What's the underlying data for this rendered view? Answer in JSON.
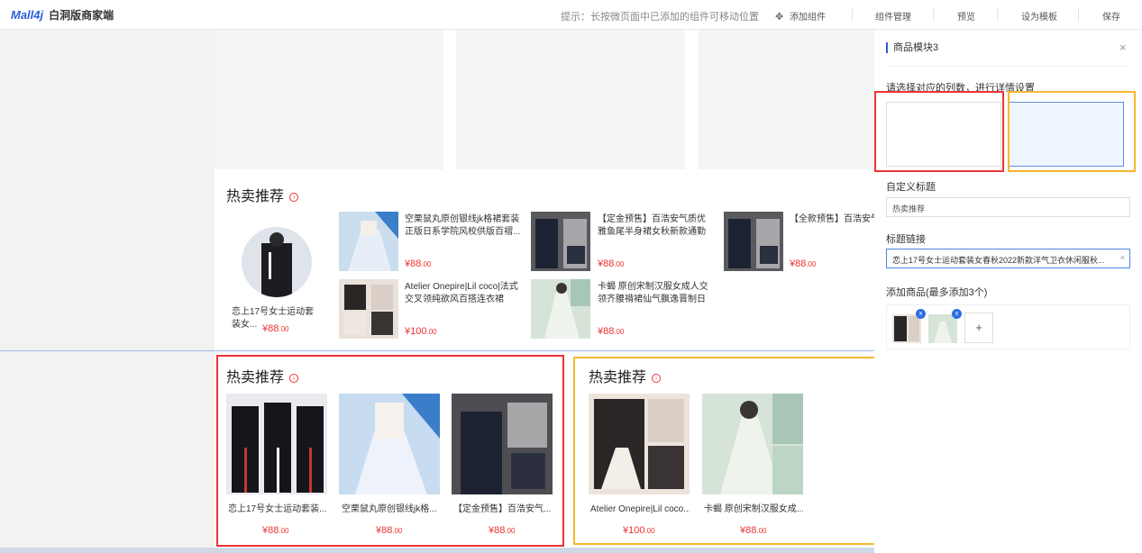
{
  "header": {
    "logo": "Mall4j",
    "subtitle": "白洞版商家端",
    "tip": "提示：长按微页面中已添加的组件可移动位置",
    "add_component": "添加组件",
    "component_manage": "组件管理",
    "preview": "预览",
    "set_template": "设为模板",
    "save": "保存"
  },
  "upper_module": {
    "title": "热卖推荐",
    "main_product": {
      "name": "恋上17号女士运动套装女...",
      "price": "88",
      "price_dec": ".00",
      "currency": "¥"
    },
    "products": [
      {
        "name": "空栗鼠丸原创银线jk格裙套装正版日系学院风校供版百褶...",
        "price": "88",
        "price_dec": ".00",
        "currency": "¥"
      },
      {
        "name": "【定金预售】百浩安气质优雅鱼尾半身裙女秋新款通勤职...",
        "price": "88",
        "price_dec": ".00",
        "currency": "¥"
      },
      {
        "name": "【全款预售】百浩安气质优雅鱼尾半身裙女秋新款通勤职...",
        "price": "88",
        "price_dec": ".00",
        "currency": "¥"
      },
      {
        "name": "Atelier Onepire|Lil coco|法式交叉领纯欲风百搭连衣裙Atel...",
        "price": "100",
        "price_dec": ".00",
        "currency": "¥"
      },
      {
        "name": "卡蝎 原创宋制汉服女成人交领齐腰褙裙仙气飘逸晋制日常...",
        "price": "88",
        "price_dec": ".00",
        "currency": "¥"
      }
    ]
  },
  "lower_left": {
    "title": "热卖推荐",
    "products": [
      {
        "name": "恋上17号女士运动套装...",
        "price": "88",
        "price_dec": ".00",
        "currency": "¥"
      },
      {
        "name": "空栗鼠丸原创银线jk格...",
        "price": "88",
        "price_dec": ".00",
        "currency": "¥"
      },
      {
        "name": "【定金预售】百浩安气...",
        "price": "88",
        "price_dec": ".00",
        "currency": "¥"
      }
    ]
  },
  "lower_right": {
    "title": "热卖推荐",
    "products": [
      {
        "name": "Atelier Onepire|Lil coco...",
        "price": "100",
        "price_dec": ".00",
        "currency": "¥"
      },
      {
        "name": "卡蝎 原创宋制汉服女成...",
        "price": "88",
        "price_dec": ".00",
        "currency": "¥"
      }
    ]
  },
  "panel": {
    "title": "商品模块3",
    "select_columns_label": "请选择对应的列数，进行详情设置",
    "custom_title_label": "自定义标题",
    "custom_title_value": "热卖推荐",
    "title_link_label": "标题链接",
    "title_link_value": "恋上17号女士运动套装女春秋2022新款洋气卫衣休闲服秋...",
    "add_products_label": "添加商品(最多添加3个)",
    "plus": "+",
    "badge": "x"
  },
  "colors": {
    "accent": "#2b5fd9",
    "price": "#e33333",
    "red_frame": "#e33333",
    "yellow_frame": "#f5b82e"
  }
}
